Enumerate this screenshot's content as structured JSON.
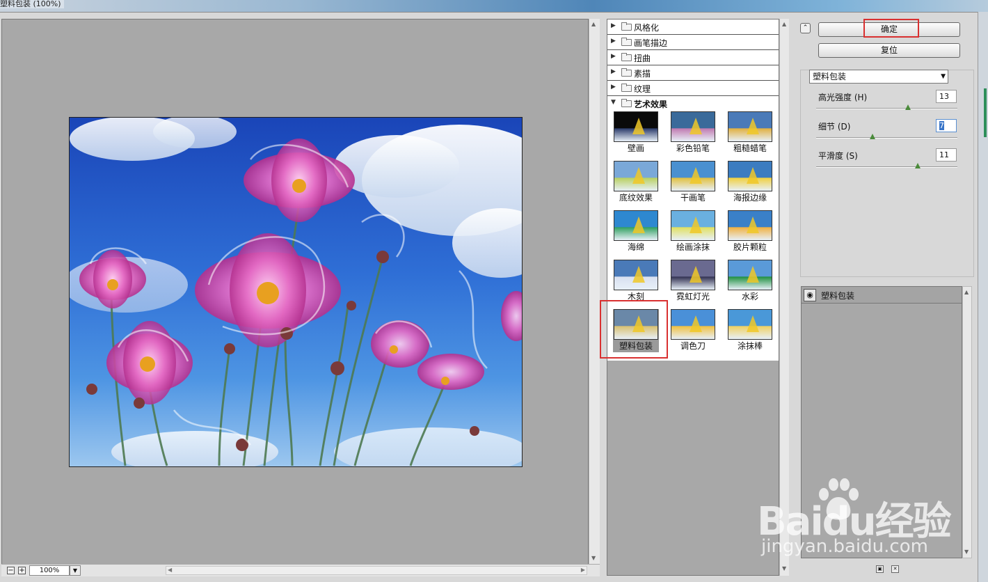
{
  "window": {
    "title": "塑料包装 (100%)"
  },
  "zoom": {
    "value": "100%",
    "minus": "−",
    "plus": "+"
  },
  "categories": [
    {
      "label": "风格化",
      "open": false
    },
    {
      "label": "画笔描边",
      "open": false
    },
    {
      "label": "扭曲",
      "open": false
    },
    {
      "label": "素描",
      "open": false
    },
    {
      "label": "纹理",
      "open": false
    },
    {
      "label": "艺术效果",
      "open": true
    }
  ],
  "filters": [
    {
      "label": "壁画"
    },
    {
      "label": "彩色铅笔"
    },
    {
      "label": "粗糙蜡笔"
    },
    {
      "label": "底纹效果"
    },
    {
      "label": "干画笔"
    },
    {
      "label": "海报边缘"
    },
    {
      "label": "海绵"
    },
    {
      "label": "绘画涂抹"
    },
    {
      "label": "胶片颗粒"
    },
    {
      "label": "木刻"
    },
    {
      "label": "霓虹灯光"
    },
    {
      "label": "水彩"
    },
    {
      "label": "塑料包装"
    },
    {
      "label": "调色刀"
    },
    {
      "label": "涂抹棒"
    }
  ],
  "selected_filter": "塑料包装",
  "buttons": {
    "ok": "确定",
    "reset": "复位"
  },
  "filter_select": {
    "value": "塑料包装"
  },
  "params": [
    {
      "label": "高光强度 (H)",
      "value": "13",
      "level": 0.65
    },
    {
      "label": "细节 (D)",
      "value": "7",
      "level": 0.4
    },
    {
      "label": "平滑度 (S)",
      "value": "11",
      "level": 0.72
    }
  ],
  "layers": [
    {
      "name": "塑料包装"
    }
  ],
  "watermark": {
    "brand": "Baidu经验",
    "url": "jingyan.baidu.com"
  },
  "colors": {
    "highlight": "#d93030",
    "accent": "#3874c8"
  }
}
